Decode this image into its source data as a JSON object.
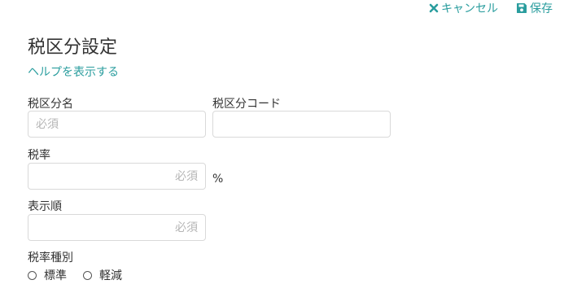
{
  "toolbar": {
    "cancel_label": "キャンセル",
    "save_label": "保存"
  },
  "page": {
    "title": "税区分設定",
    "help_link": "ヘルプを表示する"
  },
  "form": {
    "tax_name": {
      "label": "税区分名",
      "placeholder": "必須",
      "value": ""
    },
    "tax_code": {
      "label": "税区分コード",
      "placeholder": "",
      "value": ""
    },
    "tax_rate": {
      "label": "税率",
      "placeholder": "必須",
      "value": "",
      "unit": "%"
    },
    "display_order": {
      "label": "表示順",
      "placeholder": "必須",
      "value": ""
    },
    "tax_rate_type": {
      "label": "税率種別",
      "options": [
        {
          "label": "標準",
          "selected": false
        },
        {
          "label": "軽減",
          "selected": false
        }
      ]
    }
  },
  "colors": {
    "accent": "#2a9d9e",
    "text": "#333333",
    "border": "#d9d9d9",
    "placeholder": "#b5b5b5"
  },
  "icons": {
    "cancel": "close-icon",
    "save": "floppy-disk-icon"
  }
}
